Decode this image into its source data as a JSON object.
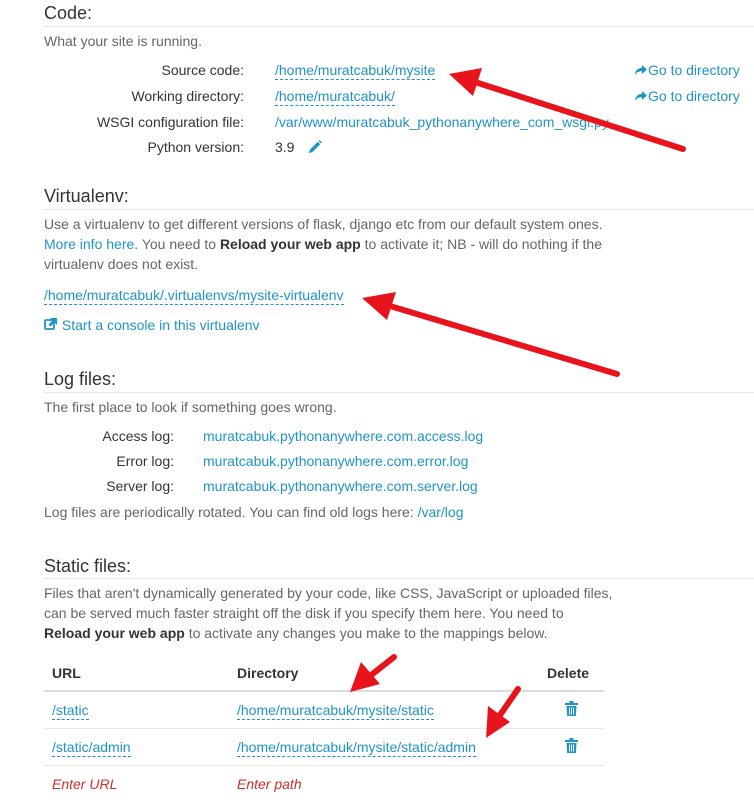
{
  "code": {
    "title": "Code:",
    "description": "What your site is running.",
    "rows": [
      {
        "label": "Source code:",
        "value": "/home/muratcabuk/mysite",
        "goto": "Go to directory"
      },
      {
        "label": "Working directory:",
        "value": "/home/muratcabuk/",
        "goto": "Go to directory"
      },
      {
        "label": "WSGI configuration file:",
        "value": "/var/www/muratcabuk_pythonanywhere_com_wsgi.py"
      },
      {
        "label": "Python version:",
        "value": "3.9"
      }
    ]
  },
  "virtualenv": {
    "title": "Virtualenv:",
    "desc_part1": "Use a virtualenv to get different versions of flask, django etc from our default system",
    "desc_part2": "ones.",
    "more_info": "More info here.",
    "desc_part3": "You need to",
    "reload": "Reload your web app",
    "desc_part4": "to activate it; NB - will do nothing",
    "desc_part5": "if the virtualenv does not exist.",
    "path": "/home/muratcabuk/.virtualenvs/mysite-virtualenv",
    "console_link": "Start a console in this virtualenv"
  },
  "logs": {
    "title": "Log files:",
    "description": "The first place to look if something goes wrong.",
    "rows": [
      {
        "label": "Access log:",
        "value": "muratcabuk.pythonanywhere.com.access.log"
      },
      {
        "label": "Error log:",
        "value": "muratcabuk.pythonanywhere.com.error.log"
      },
      {
        "label": "Server log:",
        "value": "muratcabuk.pythonanywhere.com.server.log"
      }
    ],
    "rotation_text": "Log files are periodically rotated. You can find old logs here:",
    "rotation_link": "/var/log"
  },
  "static": {
    "title": "Static files:",
    "desc_line1": "Files that aren't dynamically generated by your code, like CSS, JavaScript or uploaded files,",
    "desc_line2": "can be served much faster straight off the disk if you specify them here. You need to",
    "reload": "Reload your web app",
    "desc_line3": "to activate any changes you make to the mappings below.",
    "columns": {
      "url": "URL",
      "directory": "Directory",
      "delete": "Delete"
    },
    "rows": [
      {
        "url": "/static",
        "directory": "/home/muratcabuk/mysite/static"
      },
      {
        "url": "/static/admin",
        "directory": "/home/muratcabuk/mysite/static/admin"
      }
    ],
    "new_row": {
      "url": "Enter URL",
      "directory": "Enter path"
    }
  },
  "colors": {
    "link": "#1f93c8",
    "annotation_arrow": "#e8141b",
    "error_placeholder": "#c9302c"
  }
}
